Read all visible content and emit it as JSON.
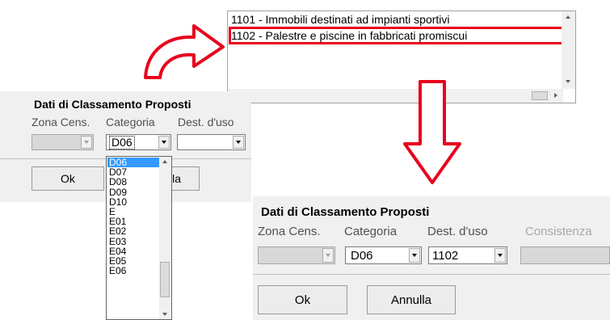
{
  "listbox": {
    "items": [
      "1101 - Immobili destinati ad impianti sportivi",
      "1102 - Palestre e piscine in fabbricati promiscui"
    ],
    "highlighted_index": 1,
    "highlight_color": "#e8001c"
  },
  "small_dialog": {
    "title": "Dati di Classamento Proposti",
    "zona_label": "Zona Cens.",
    "categoria_label": "Categoria",
    "dest_label": "Dest. d'uso",
    "categoria_value": "D06",
    "dest_value": "",
    "ok_label": "Ok",
    "annulla_partial": "lla",
    "dropdown_items": [
      "D06",
      "D07",
      "D08",
      "D09",
      "D10",
      "E",
      "E01",
      "E02",
      "E03",
      "E04",
      "E05",
      "E06"
    ],
    "dropdown_selected": "D06"
  },
  "large_dialog": {
    "title": "Dati di Classamento Proposti",
    "zona_label": "Zona Cens.",
    "categoria_label": "Categoria",
    "dest_label": "Dest. d'uso",
    "consistenza_label": "Consistenza",
    "categoria_value": "D06",
    "dest_value": "1102",
    "ok_label": "Ok",
    "annulla_label": "Annulla"
  },
  "icons": {
    "curved_arrow": "curved-arrow-icon",
    "down_arrow": "down-arrow-icon"
  },
  "colors": {
    "arrow_red": "#e8001c",
    "panel_bg": "#f0f0f0",
    "selection_blue": "#3399ff"
  }
}
